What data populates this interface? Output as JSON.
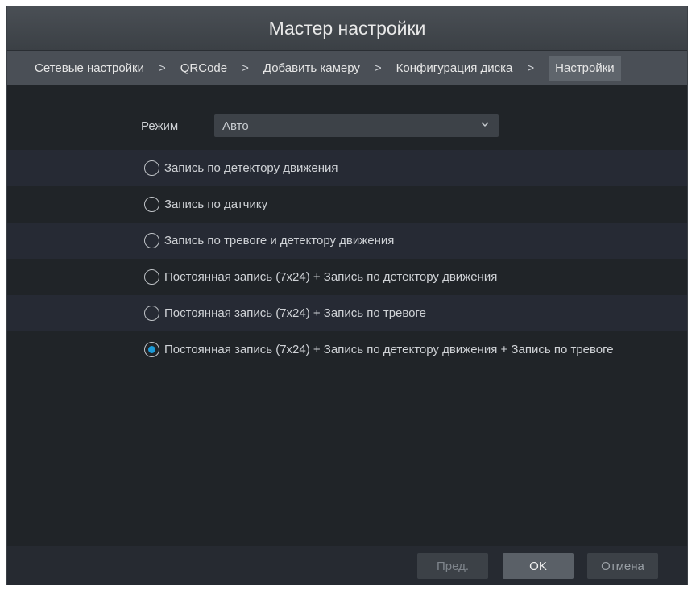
{
  "window": {
    "title": "Мастер настройки"
  },
  "steps": [
    {
      "label": "Сетевые настройки"
    },
    {
      "label": "QRCode"
    },
    {
      "label": "Добавить камеру"
    },
    {
      "label": "Конфигурация диска"
    },
    {
      "label": "Настройки",
      "active": true
    }
  ],
  "step_separator": ">",
  "mode": {
    "label": "Режим",
    "value": "Авто"
  },
  "options": [
    {
      "label": "Запись по детектору движения",
      "selected": false
    },
    {
      "label": "Запись по датчику",
      "selected": false
    },
    {
      "label": "Запись по тревоге и детектору движения",
      "selected": false
    },
    {
      "label": "Постоянная запись (7x24) + Запись по детектору движения",
      "selected": false
    },
    {
      "label": "Постоянная запись (7x24) + Запись по тревоге",
      "selected": false
    },
    {
      "label": "Постоянная запись (7x24) + Запись по детектору движения + Запись по тревоге",
      "selected": true
    }
  ],
  "buttons": {
    "prev": "Пред.",
    "ok": "OK",
    "cancel": "Отмена"
  },
  "colors": {
    "background": "#202428",
    "accent": "#1c9ad6"
  },
  "icons": {
    "dropdown": "chevron-down-icon",
    "separator": "chevron-right-icon"
  }
}
